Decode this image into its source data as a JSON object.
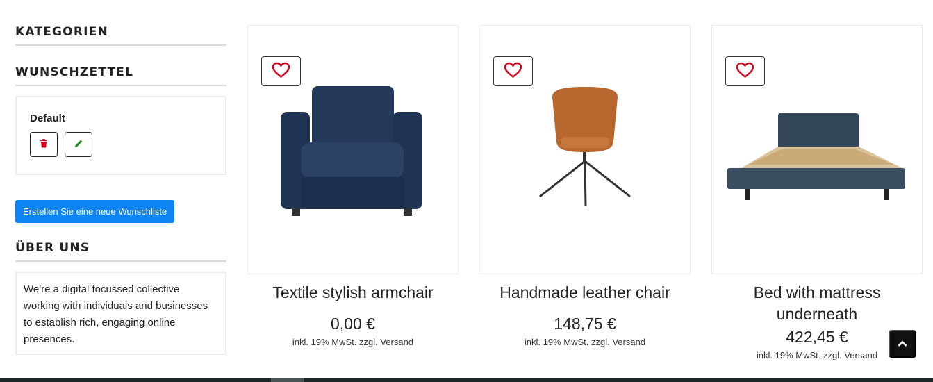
{
  "sidebar": {
    "categories_title": "KATEGORIEN",
    "wishlist_title": "WUNSCHZETTEL",
    "wishlist_name": "Default",
    "create_wishlist_label": "Erstellen Sie eine neue Wunschliste",
    "about_title": "ÜBER UNS",
    "about_text": "We're a digital focussed collective working with individuals and businesses to establish rich, engaging online presences."
  },
  "products": [
    {
      "name": "Textile stylish armchair",
      "price": "0,00 €",
      "tax": "inkl. 19% MwSt. zzgl.  Versand"
    },
    {
      "name": "Handmade leather chair",
      "price": "148,75 €",
      "tax": "inkl. 19% MwSt. zzgl.  Versand"
    },
    {
      "name": "Bed with mattress underneath",
      "price": "422,45 €",
      "tax": "inkl. 19% MwSt. zzgl.  Versand"
    }
  ],
  "icons": {
    "wishlist_heart": "heart-icon",
    "delete": "trash-icon",
    "edit": "pencil-icon",
    "scroll_top": "chevron-up-icon"
  },
  "colors": {
    "primary_button": "#0d84f2",
    "heart": "#d0021b",
    "delete": "#d0021b",
    "edit": "#1a8a1a",
    "footer": "#1e2526"
  }
}
